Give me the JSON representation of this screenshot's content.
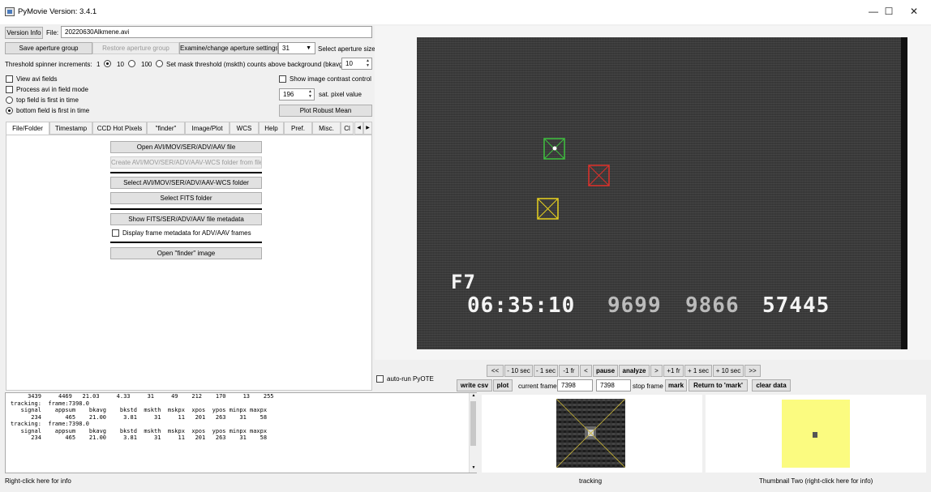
{
  "window": {
    "title": "PyMovie  Version: 3.4.1",
    "min_label": "—",
    "max_label": "☐",
    "close_label": "✕"
  },
  "top": {
    "version_info_label": "Version Info",
    "file_label": "File:",
    "file_value": "20220630Alkmene.avi",
    "save_aperture_label": "Save aperture group",
    "restore_aperture_label": "Restore aperture group",
    "examine_aperture_label": "Examine/change aperture settings",
    "aperture_size_value": "31",
    "aperture_size_label": "Select aperture size",
    "threshold_increments_label": "Threshold spinner increments:",
    "inc_1": "1",
    "inc_10": "10",
    "inc_100": "100",
    "mask_threshold_label": "Set mask threshold (mskth) counts above background (bkavg)",
    "mask_threshold_value": "10",
    "view_avi_fields_label": "View avi fields",
    "process_field_mode_label": "Process avi in field mode",
    "top_field_first_label": "top field is first in time",
    "bottom_field_first_label": "bottom field is first in time",
    "show_contrast_label": "Show image contrast control",
    "sat_pixel_value": "196",
    "sat_pixel_label": "sat. pixel value",
    "plot_robust_mean_label": "Plot Robust Mean"
  },
  "tabs": [
    "File/Folder",
    "Timestamp",
    "CCD Hot Pixels",
    "\"finder\"",
    "Image/Plot",
    "WCS",
    "Help",
    "Pref.",
    "Misc.",
    "Cl"
  ],
  "file_panel": {
    "open_avi": "Open AVI/MOV/SER/ADV/AAV file",
    "create_wcs_folder": "Create AVI/MOV/SER/ADV/AAV-WCS folder from file",
    "select_wcs_folder": "Select AVI/MOV/SER/ADV/AAV-WCS folder",
    "select_fits_folder": "Select FITS folder",
    "show_metadata": "Show FITS/SER/ADV/AAV file metadata",
    "display_frame_metadata": "Display frame metadata for ADV/AAV frames",
    "open_finder": "Open \"finder\" image"
  },
  "video": {
    "osd_line1": "F7",
    "osd_time": "06:35:10",
    "osd_num1": "9699",
    "osd_num2": "9866",
    "osd_num3": "57445"
  },
  "playback": {
    "buttons": [
      "<<",
      "- 10 sec",
      "- 1 sec",
      "-1 fr",
      "<",
      "pause",
      "analyze",
      ">",
      "+1 fr",
      "+ 1 sec",
      "+ 10 sec",
      ">>"
    ],
    "auto_run_pyote": "auto-run PyOTE",
    "write_csv": "write csv",
    "plot": "plot",
    "current_frame_label": "current frame",
    "current_frame_value": "7398",
    "stop_frame_value": "7398",
    "stop_frame_label": "stop frame",
    "mark": "mark",
    "return_to_mark": "Return to 'mark'",
    "clear_data": "clear data"
  },
  "console_lines": [
    "     3439     4469   21.03     4.33     31     49    212    170     13    255",
    "",
    "tracking:  frame:7398.0",
    "   signal    appsum    bkavg    bkstd  mskth  mskpx  xpos  ypos minpx maxpx",
    "      234       465    21.00     3.81     31     11   201   263    31    58",
    "",
    "tracking:  frame:7398.0",
    "   signal    appsum    bkavg    bkstd  mskth  mskpx  xpos  ypos minpx maxpx",
    "      234       465    21.00     3.81     31     11   201   263    31    58"
  ],
  "status": {
    "left": "Right-click here for info",
    "thumb1": "tracking",
    "thumb2": "Thumbnail Two (right-click here for info)"
  },
  "colors": {
    "aperture_green": "#3ec23e",
    "aperture_red": "#e0302a",
    "aperture_yellow": "#e8d21e",
    "thumb_two_bg": "#fbfb80"
  }
}
